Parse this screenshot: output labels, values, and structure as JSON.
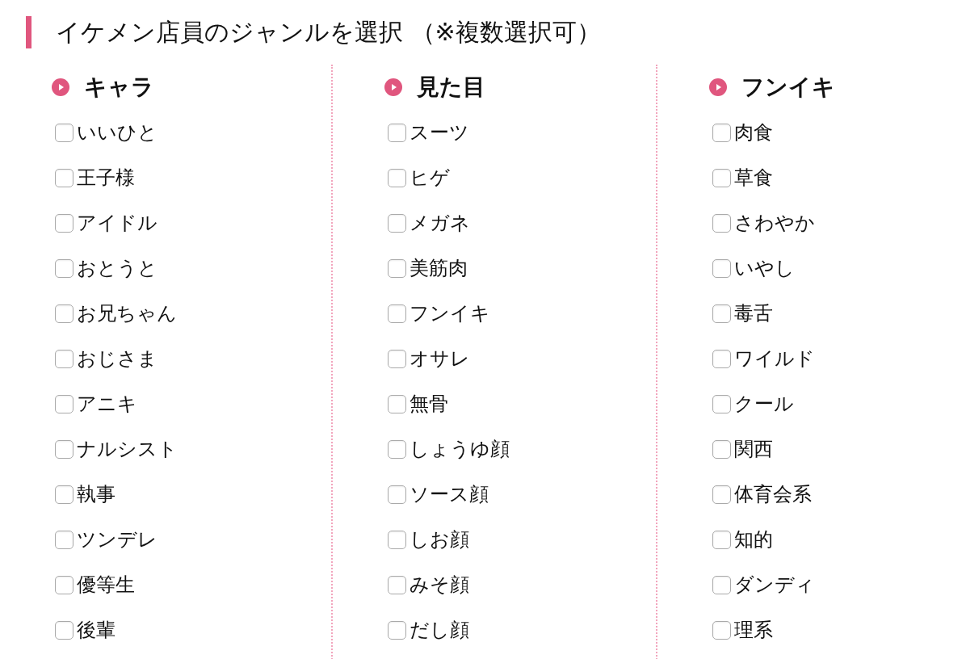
{
  "title": "イケメン店員のジャンルを選択 （※複数選択可）",
  "groups": [
    {
      "heading": "キャラ",
      "options": [
        {
          "label": "いいひと",
          "checked": false
        },
        {
          "label": "王子様",
          "checked": false
        },
        {
          "label": "アイドル",
          "checked": false
        },
        {
          "label": "おとうと",
          "checked": false
        },
        {
          "label": "お兄ちゃん",
          "checked": false
        },
        {
          "label": "おじさま",
          "checked": false
        },
        {
          "label": "アニキ",
          "checked": false
        },
        {
          "label": "ナルシスト",
          "checked": false
        },
        {
          "label": "執事",
          "checked": false
        },
        {
          "label": "ツンデレ",
          "checked": false
        },
        {
          "label": "優等生",
          "checked": false
        },
        {
          "label": "後輩",
          "checked": false
        }
      ]
    },
    {
      "heading": "見た目",
      "options": [
        {
          "label": "スーツ",
          "checked": false
        },
        {
          "label": "ヒゲ",
          "checked": false
        },
        {
          "label": "メガネ",
          "checked": false
        },
        {
          "label": "美筋肉",
          "checked": false
        },
        {
          "label": "フンイキ",
          "checked": false
        },
        {
          "label": "オサレ",
          "checked": false
        },
        {
          "label": "無骨",
          "checked": false
        },
        {
          "label": "しょうゆ顔",
          "checked": false
        },
        {
          "label": "ソース顔",
          "checked": false
        },
        {
          "label": "しお顔",
          "checked": false
        },
        {
          "label": "みそ顔",
          "checked": false
        },
        {
          "label": "だし顔",
          "checked": false
        }
      ]
    },
    {
      "heading": "フンイキ",
      "options": [
        {
          "label": "肉食",
          "checked": false
        },
        {
          "label": "草食",
          "checked": false
        },
        {
          "label": "さわやか",
          "checked": false
        },
        {
          "label": "いやし",
          "checked": false
        },
        {
          "label": "毒舌",
          "checked": false
        },
        {
          "label": "ワイルド",
          "checked": false
        },
        {
          "label": "クール",
          "checked": false
        },
        {
          "label": "関西",
          "checked": false
        },
        {
          "label": "体育会系",
          "checked": false
        },
        {
          "label": "知的",
          "checked": false
        },
        {
          "label": "ダンディ",
          "checked": false
        },
        {
          "label": "理系",
          "checked": false
        }
      ]
    }
  ]
}
